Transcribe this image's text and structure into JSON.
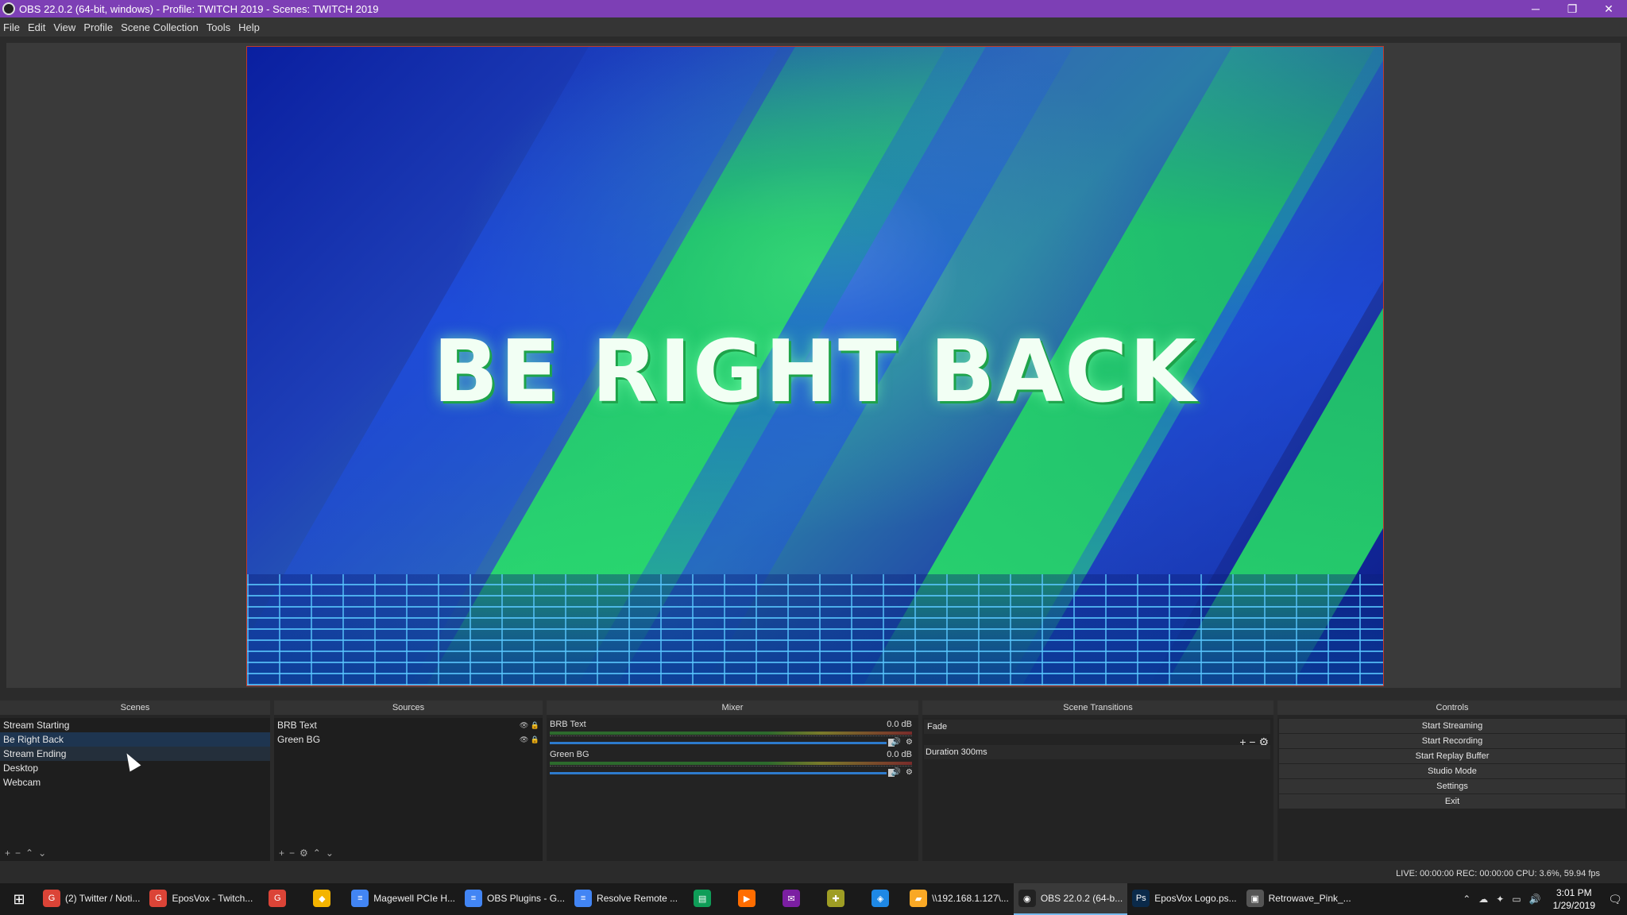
{
  "window": {
    "title": "OBS 22.0.2 (64-bit, windows) - Profile: TWITCH 2019 - Scenes: TWITCH 2019",
    "minimize": "─",
    "restore": "❐",
    "close": "✕"
  },
  "menu": [
    "File",
    "Edit",
    "View",
    "Profile",
    "Scene Collection",
    "Tools",
    "Help"
  ],
  "preview": {
    "overlay_text": "BE RIGHT BACK"
  },
  "scenes": {
    "header": "Scenes",
    "items": [
      "Stream Starting",
      "Be Right Back",
      "Stream Ending",
      "Desktop",
      "Webcam"
    ],
    "selected_index": 1,
    "toolbar": [
      "+",
      "−",
      "⌃",
      "⌄"
    ]
  },
  "sources": {
    "header": "Sources",
    "items": [
      "BRB Text",
      "Green BG"
    ],
    "item_icons": "👁 🔒",
    "toolbar": [
      "+",
      "−",
      "⚙",
      "⌃",
      "⌄"
    ]
  },
  "mixer": {
    "header": "Mixer",
    "channels": [
      {
        "name": "BRB Text",
        "db": "0.0 dB",
        "level": 1.0
      },
      {
        "name": "Green BG",
        "db": "0.0 dB",
        "level": 1.0
      }
    ],
    "mute_icon": "🔊",
    "gear_icon": "⚙"
  },
  "transitions": {
    "header": "Scene Transitions",
    "selected": "Fade",
    "controls": "+ − ⚙",
    "duration": "Duration 300ms"
  },
  "controls": {
    "header": "Controls",
    "buttons": [
      "Start Streaming",
      "Start Recording",
      "Start Replay Buffer",
      "Studio Mode",
      "Settings",
      "Exit"
    ]
  },
  "status": {
    "text": "LIVE: 00:00:00   REC: 00:00:00   CPU: 3.6%, 59.94 fps"
  },
  "taskbar": {
    "start_icon": "⊞",
    "items": [
      {
        "label": "(2) Twitter / Noti...",
        "icon": "G",
        "color": "#db4437"
      },
      {
        "label": "EposVox - Twitch...",
        "icon": "G",
        "color": "#db4437"
      },
      {
        "label": "",
        "icon": "G",
        "color": "#db4437"
      },
      {
        "label": "",
        "icon": "◆",
        "color": "#f4b400"
      },
      {
        "label": "Magewell PCIe H...",
        "icon": "≡",
        "color": "#4285f4"
      },
      {
        "label": "OBS Plugins - G...",
        "icon": "≡",
        "color": "#4285f4"
      },
      {
        "label": "Resolve Remote ...",
        "icon": "≡",
        "color": "#4285f4"
      },
      {
        "label": "",
        "icon": "▤",
        "color": "#0f9d58"
      },
      {
        "label": "",
        "icon": "▶",
        "color": "#ff6d00"
      },
      {
        "label": "",
        "icon": "✉",
        "color": "#7b1fa2"
      },
      {
        "label": "",
        "icon": "✚",
        "color": "#9e9d24"
      },
      {
        "label": "",
        "icon": "◈",
        "color": "#1e88e5"
      },
      {
        "label": "\\\\192.168.1.127\\...",
        "icon": "▰",
        "color": "#f9a825"
      },
      {
        "label": "OBS 22.0.2 (64-b...",
        "icon": "◉",
        "color": "#222222"
      },
      {
        "label": "EposVox Logo.ps...",
        "icon": "Ps",
        "color": "#0b2a4a"
      },
      {
        "label": "Retrowave_Pink_...",
        "icon": "▣",
        "color": "#555555"
      }
    ],
    "active_index": 13,
    "tray": [
      "⌃",
      "☁",
      "✦",
      "▭",
      "🔊"
    ],
    "time": "3:01 PM",
    "date": "1/29/2019",
    "notify_icon": "🗨"
  }
}
